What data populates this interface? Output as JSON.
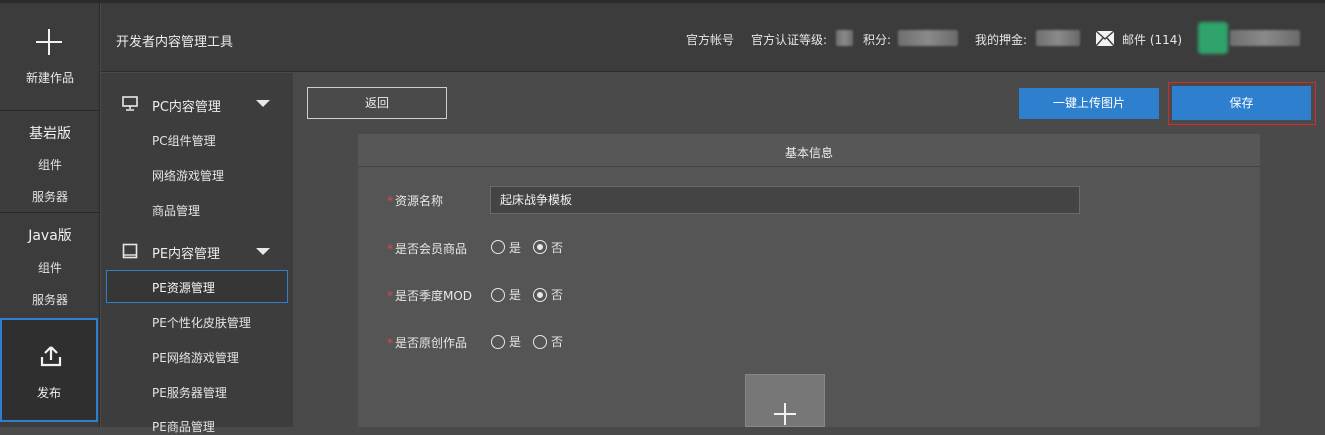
{
  "rail": {
    "new_label": "新建作品",
    "bedrock_head": "基岩版",
    "bedrock_items": [
      "组件",
      "服务器"
    ],
    "java_head": "Java版",
    "java_items": [
      "组件",
      "服务器"
    ],
    "publish_label": "发布"
  },
  "topbar": {
    "app_title": "开发者内容管理工具",
    "official_account": "官方帐号",
    "cert_level_label": "官方认证等级:",
    "points_label": "积分:",
    "deposit_label": "我的押金:",
    "mail_label": "邮件 (114)"
  },
  "nav": {
    "pc_group": "PC内容管理",
    "pc_items": [
      "PC组件管理",
      "网络游戏管理",
      "商品管理"
    ],
    "pe_group": "PE内容管理",
    "pe_items": [
      "PE资源管理",
      "PE个性化皮肤管理",
      "PE网络游戏管理",
      "PE服务器管理",
      "PE商品管理"
    ],
    "active_item": "PE资源管理"
  },
  "toolbar": {
    "back_label": "返回",
    "upload_label": "一键上传图片",
    "save_label": "保存"
  },
  "form": {
    "section_title": "基本信息",
    "required_mark": "*",
    "resource_name_label": "资源名称",
    "resource_name_value": "起床战争模板",
    "member_item_label": "是否会员商品",
    "season_mod_label": "是否季度MOD",
    "original_label": "是否原创作品",
    "yes_label": "是",
    "no_label": "否",
    "member_item_value": "否",
    "season_mod_value": "否",
    "original_value": ""
  },
  "colors": {
    "accent": "#2f7fcf",
    "save_highlight": "#d22b2b",
    "required": "#e04848"
  }
}
